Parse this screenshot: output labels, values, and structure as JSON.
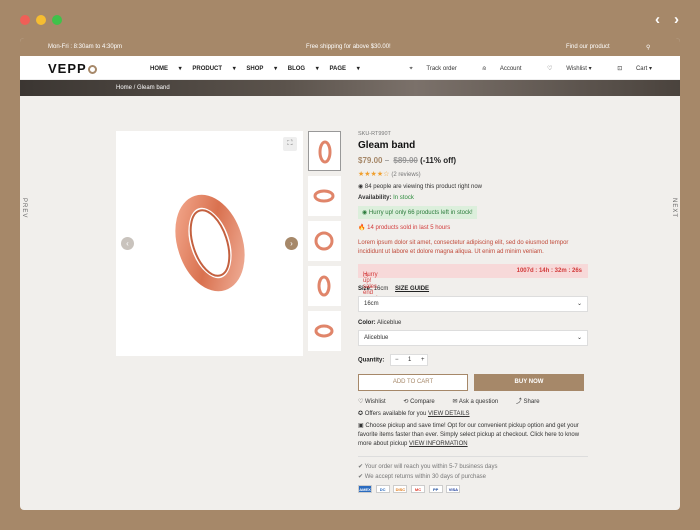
{
  "window": {
    "controls": [
      "close",
      "minimize",
      "maximize"
    ]
  },
  "browser_nav": {
    "back": "‹",
    "forward": "›"
  },
  "topbar": {
    "hours": "Mon-Fri : 8:30am to 4:30pm",
    "shipping": "Free shipping for above $30.00!",
    "find": "Find our product"
  },
  "header": {
    "logo": "VEPP",
    "menu": [
      "HOME",
      "PRODUCT",
      "SHOP",
      "BLOG",
      "PAGE"
    ],
    "track": "Track order",
    "account": "Account",
    "wishlist": "Wishlist",
    "cart": "Cart"
  },
  "breadcrumb": "Home / Gleam band",
  "side": {
    "prev": "PREV",
    "next": "NEXT"
  },
  "product": {
    "sku": "SKU-RT990T",
    "title": "Gleam band",
    "price": "$79.00",
    "tilde": "–",
    "old_price": "$89.00",
    "discount": "(-11% off)",
    "stars": "★★★★☆",
    "reviews": "(2 reviews)",
    "viewing": "84 people are viewing this product right now",
    "availability_label": "Availability:",
    "availability": "In stock",
    "hurry": "Hurry up! only 66 products left in stock!",
    "sold": "14 products sold in last 5 hours",
    "desc": "Lorem ipsum dolor sit amet, consectetur adipiscing elit, sed do eiusmod tempor incididunt ut labore et dolore magna aliqua. Ut enim ad minim veniam.",
    "sale_text": "Hurry up! sales end soon!",
    "countdown": "1007d : 14h : 32m : 26s",
    "size_label": "Size:",
    "size_value": "16cm",
    "size_guide": "SIZE GUIDE",
    "size_select": "16cm",
    "color_label": "Color:",
    "color_value": "Aliceblue",
    "color_select": "Aliceblue",
    "qty_label": "Quantity:",
    "qty": "1",
    "add_to_cart": "ADD TO CART",
    "buy_now": "BUY NOW",
    "wishlist": "Wishlist",
    "compare": "Compare",
    "ask": "Ask a question",
    "share": "Share",
    "offers": "Offers available for you",
    "view_details": "VIEW DETAILS",
    "pickup": "Choose pickup and save time! Opt for our convenient pickup option and get your favorite items faster than ever. Simply select pickup at checkout. Click here to know more about pickup",
    "view_info": "VIEW INFORMATION",
    "note1": "Your order will reach you within 5-7 business days",
    "note2": "We accept returns within 30 days of purchase",
    "payments": [
      "AMEX",
      "DC",
      "DISC",
      "MC",
      "PP",
      "VISA"
    ]
  },
  "colors": {
    "accent": "#a68869",
    "ring": "#e0856a"
  }
}
